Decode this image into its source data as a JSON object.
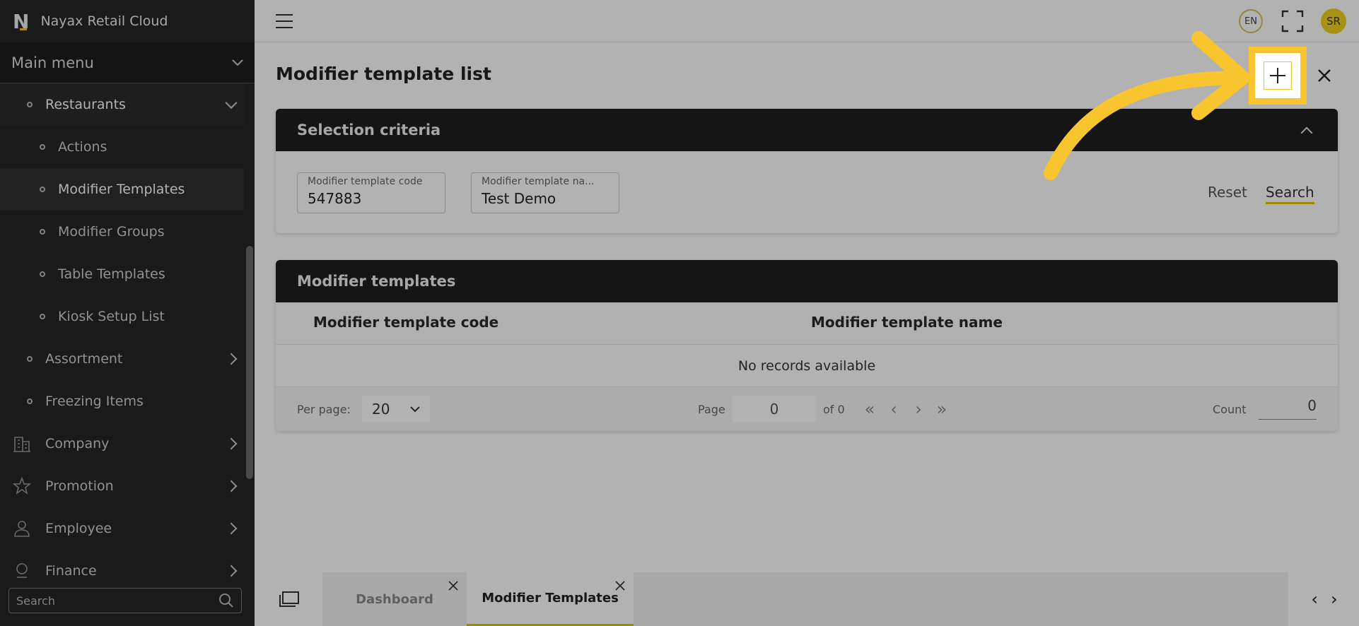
{
  "brand": {
    "name": "Nayax Retail Cloud",
    "logo_letter": "N"
  },
  "sidebar": {
    "main_menu_label": "Main menu",
    "items": [
      {
        "label": "Restaurants",
        "level": 1,
        "state": "open"
      },
      {
        "label": "Actions",
        "level": 2
      },
      {
        "label": "Modifier Templates",
        "level": 2,
        "state": "selected"
      },
      {
        "label": "Modifier Groups",
        "level": 2
      },
      {
        "label": "Table Templates",
        "level": 2
      },
      {
        "label": "Kiosk Setup List",
        "level": 2
      },
      {
        "label": "Assortment",
        "level": 1
      },
      {
        "label": "Freezing Items",
        "level": 1
      },
      {
        "label": "Company",
        "icon": "building-icon"
      },
      {
        "label": "Promotion",
        "icon": "star-icon"
      },
      {
        "label": "Employee",
        "icon": "person-icon"
      },
      {
        "label": "Finance",
        "icon": "finance-icon"
      }
    ],
    "search_placeholder": "Search"
  },
  "topbar": {
    "language": "EN",
    "user_initials": "SR"
  },
  "page": {
    "title": "Modifier template list",
    "selection": {
      "header": "Selection criteria",
      "code_label": "Modifier template code",
      "code_value": "547883",
      "name_label": "Modifier template na...",
      "name_value": "Test Demo",
      "reset_label": "Reset",
      "search_label": "Search"
    },
    "table": {
      "header": "Modifier templates",
      "columns": [
        "Modifier template code",
        "Modifier template name"
      ],
      "empty_text": "No records available",
      "per_page_label": "Per page:",
      "per_page_value": "20",
      "page_label": "Page",
      "page_value": "0",
      "of_label": "of 0",
      "count_label": "Count",
      "count_value": "0"
    }
  },
  "tabs": [
    {
      "label": "Dashboard",
      "active": false
    },
    {
      "label": "Modifier Templates",
      "active": true
    }
  ],
  "colors": {
    "accent": "#f8c52e",
    "sidebar_bg": "#262626",
    "header_bg": "#1f1f1f"
  }
}
